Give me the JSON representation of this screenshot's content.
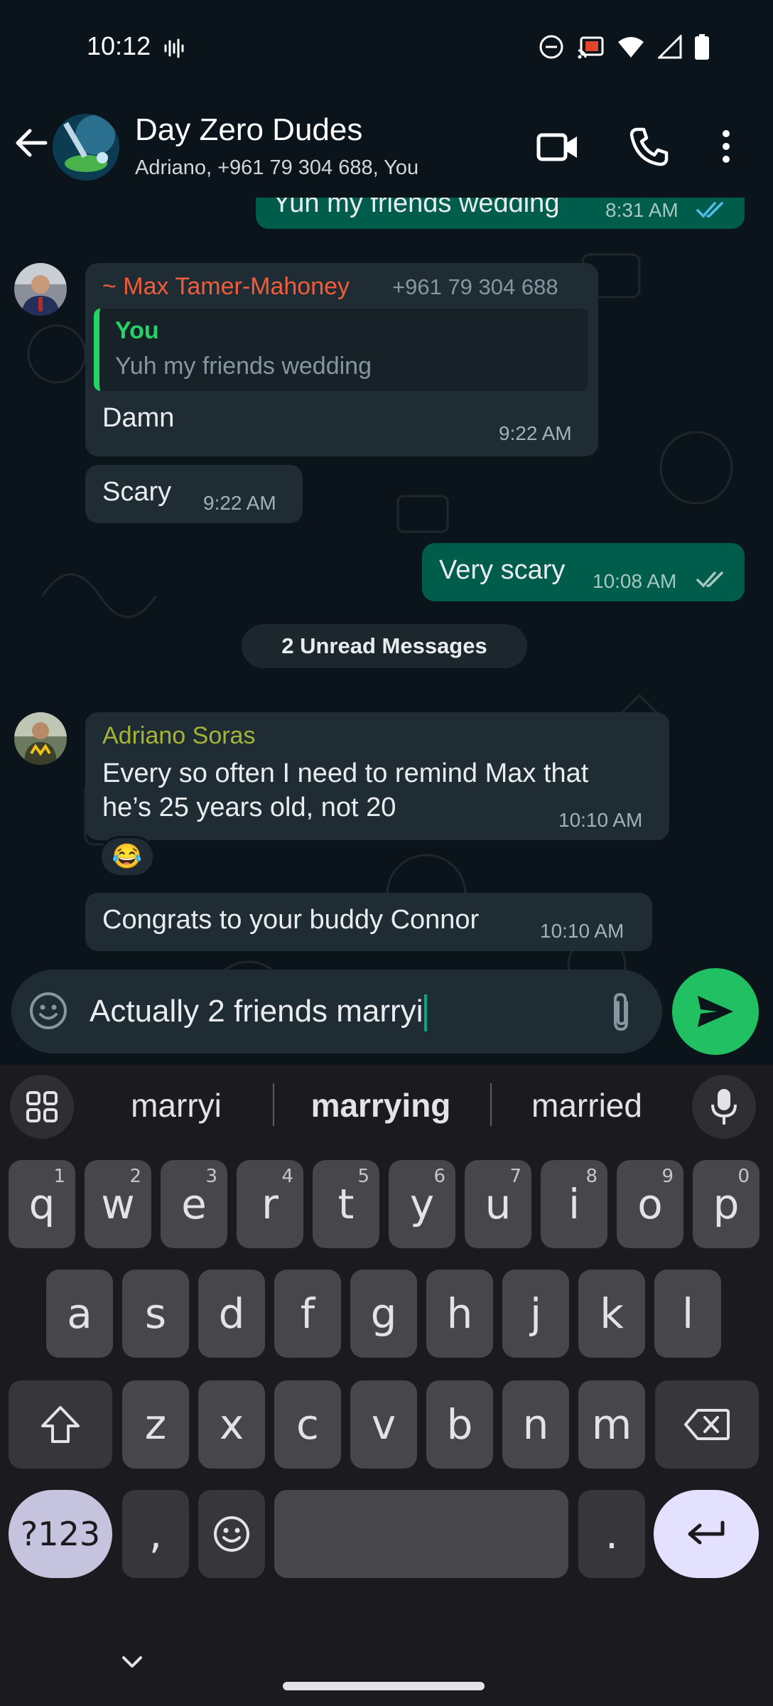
{
  "status": {
    "time": "10:12"
  },
  "header": {
    "title": "Day Zero Dudes",
    "subtitle": "Adriano, +961 79 304 688, You"
  },
  "messages": {
    "m1": {
      "text": "Yuh my friends wedding",
      "time": "8:31 AM"
    },
    "m2": {
      "sender": "~ Max Tamer-Mahoney",
      "phone": "+961 79 304 688",
      "quote_author": "You",
      "quote_text": "Yuh my friends wedding",
      "text": "Damn",
      "time": "9:22 AM"
    },
    "m3": {
      "text": "Scary",
      "time": "9:22 AM"
    },
    "m4": {
      "text": "Very scary",
      "time": "10:08 AM"
    },
    "unread": "2 Unread Messages",
    "m5": {
      "sender": "Adriano Soras",
      "text_line1": "Every so often I need to remind Max that",
      "text_line2": "he’s 25 years old, not 20",
      "time": "10:10 AM",
      "reaction": "😂"
    },
    "m6": {
      "text": "Congrats to your buddy Connor",
      "time": "10:10 AM"
    }
  },
  "composer": {
    "text": "Actually 2 friends marryi"
  },
  "keyboard": {
    "suggestions": [
      "marryi",
      "marrying",
      "married"
    ],
    "row1": [
      {
        "k": "q",
        "n": "1"
      },
      {
        "k": "w",
        "n": "2"
      },
      {
        "k": "e",
        "n": "3"
      },
      {
        "k": "r",
        "n": "4"
      },
      {
        "k": "t",
        "n": "5"
      },
      {
        "k": "y",
        "n": "6"
      },
      {
        "k": "u",
        "n": "7"
      },
      {
        "k": "i",
        "n": "8"
      },
      {
        "k": "o",
        "n": "9"
      },
      {
        "k": "p",
        "n": "0"
      }
    ],
    "row2": [
      "a",
      "s",
      "d",
      "f",
      "g",
      "h",
      "j",
      "k",
      "l"
    ],
    "row3": [
      "z",
      "x",
      "c",
      "v",
      "b",
      "n",
      "m"
    ],
    "sym_label": "?123",
    "comma": ",",
    "period": "."
  },
  "colors": {
    "outgoing_bubble": "#005c4b",
    "incoming_bubble": "#1f2c34",
    "sender_max": "#f15c3a",
    "sender_adriano": "#a5b337",
    "quote_you": "#25d366",
    "send_button": "#21c063",
    "read_ticks": "#53bdeb"
  },
  "icons": {
    "back": "arrow-left-icon",
    "video": "video-camera-icon",
    "call": "phone-icon",
    "more": "more-vertical-icon",
    "emoji": "emoji-icon",
    "attach": "paperclip-icon",
    "send": "send-icon",
    "mic": "microphone-icon"
  }
}
